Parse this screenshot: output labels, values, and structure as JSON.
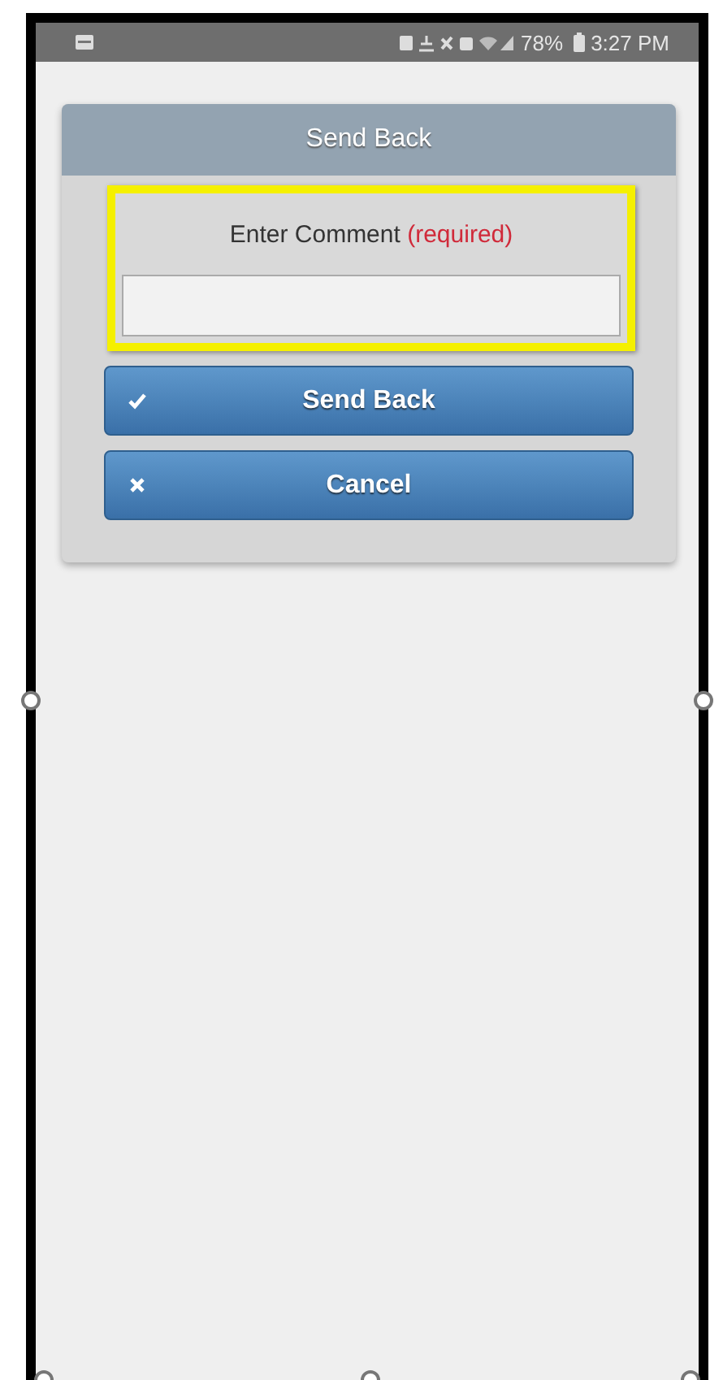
{
  "status_bar": {
    "battery_text": "78%",
    "time": "3:27 PM"
  },
  "dialog": {
    "title": "Send Back",
    "comment_field": {
      "label": "Enter Comment",
      "required_note": "(required)"
    },
    "buttons": [
      {
        "kind": "confirm",
        "label": "Send Back"
      },
      {
        "kind": "cancel",
        "label": "Cancel"
      }
    ]
  }
}
